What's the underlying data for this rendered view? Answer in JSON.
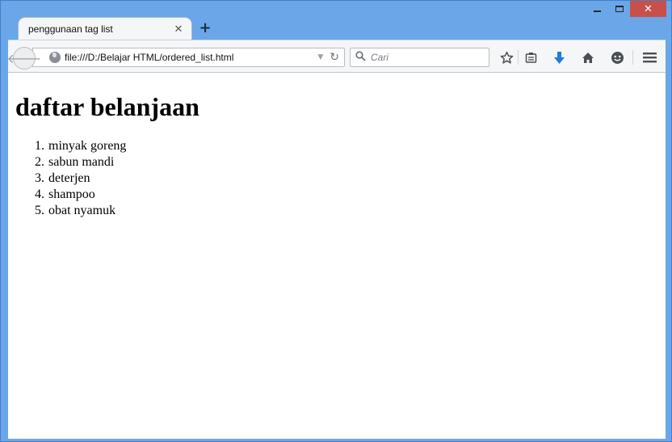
{
  "window": {
    "minimize": "",
    "maximize": "",
    "close": "✕"
  },
  "tab": {
    "title": "penggunaan tag list",
    "close": "✕",
    "new_tab": "+"
  },
  "toolbar": {
    "url": "file:///D:/Belajar HTML/ordered_list.html",
    "search_placeholder": "Cari",
    "icons": [
      "back-icon",
      "globe-icon",
      "dropdown-icon",
      "reload-icon",
      "search-icon",
      "bookmark-star-icon",
      "reading-list-icon",
      "download-icon",
      "home-icon",
      "hello-icon",
      "menu-icon"
    ]
  },
  "page": {
    "heading": "daftar belanjaan",
    "items": [
      {
        "num": "1.",
        "text": "minyak goreng"
      },
      {
        "num": "2.",
        "text": "sabun mandi"
      },
      {
        "num": "3.",
        "text": "deterjen"
      },
      {
        "num": "4.",
        "text": "shampoo"
      },
      {
        "num": "5.",
        "text": "obat nyamuk"
      }
    ]
  },
  "colors": {
    "frame": "#6ba6e8",
    "close_button": "#c7504b",
    "download_icon": "#1e7be0"
  }
}
